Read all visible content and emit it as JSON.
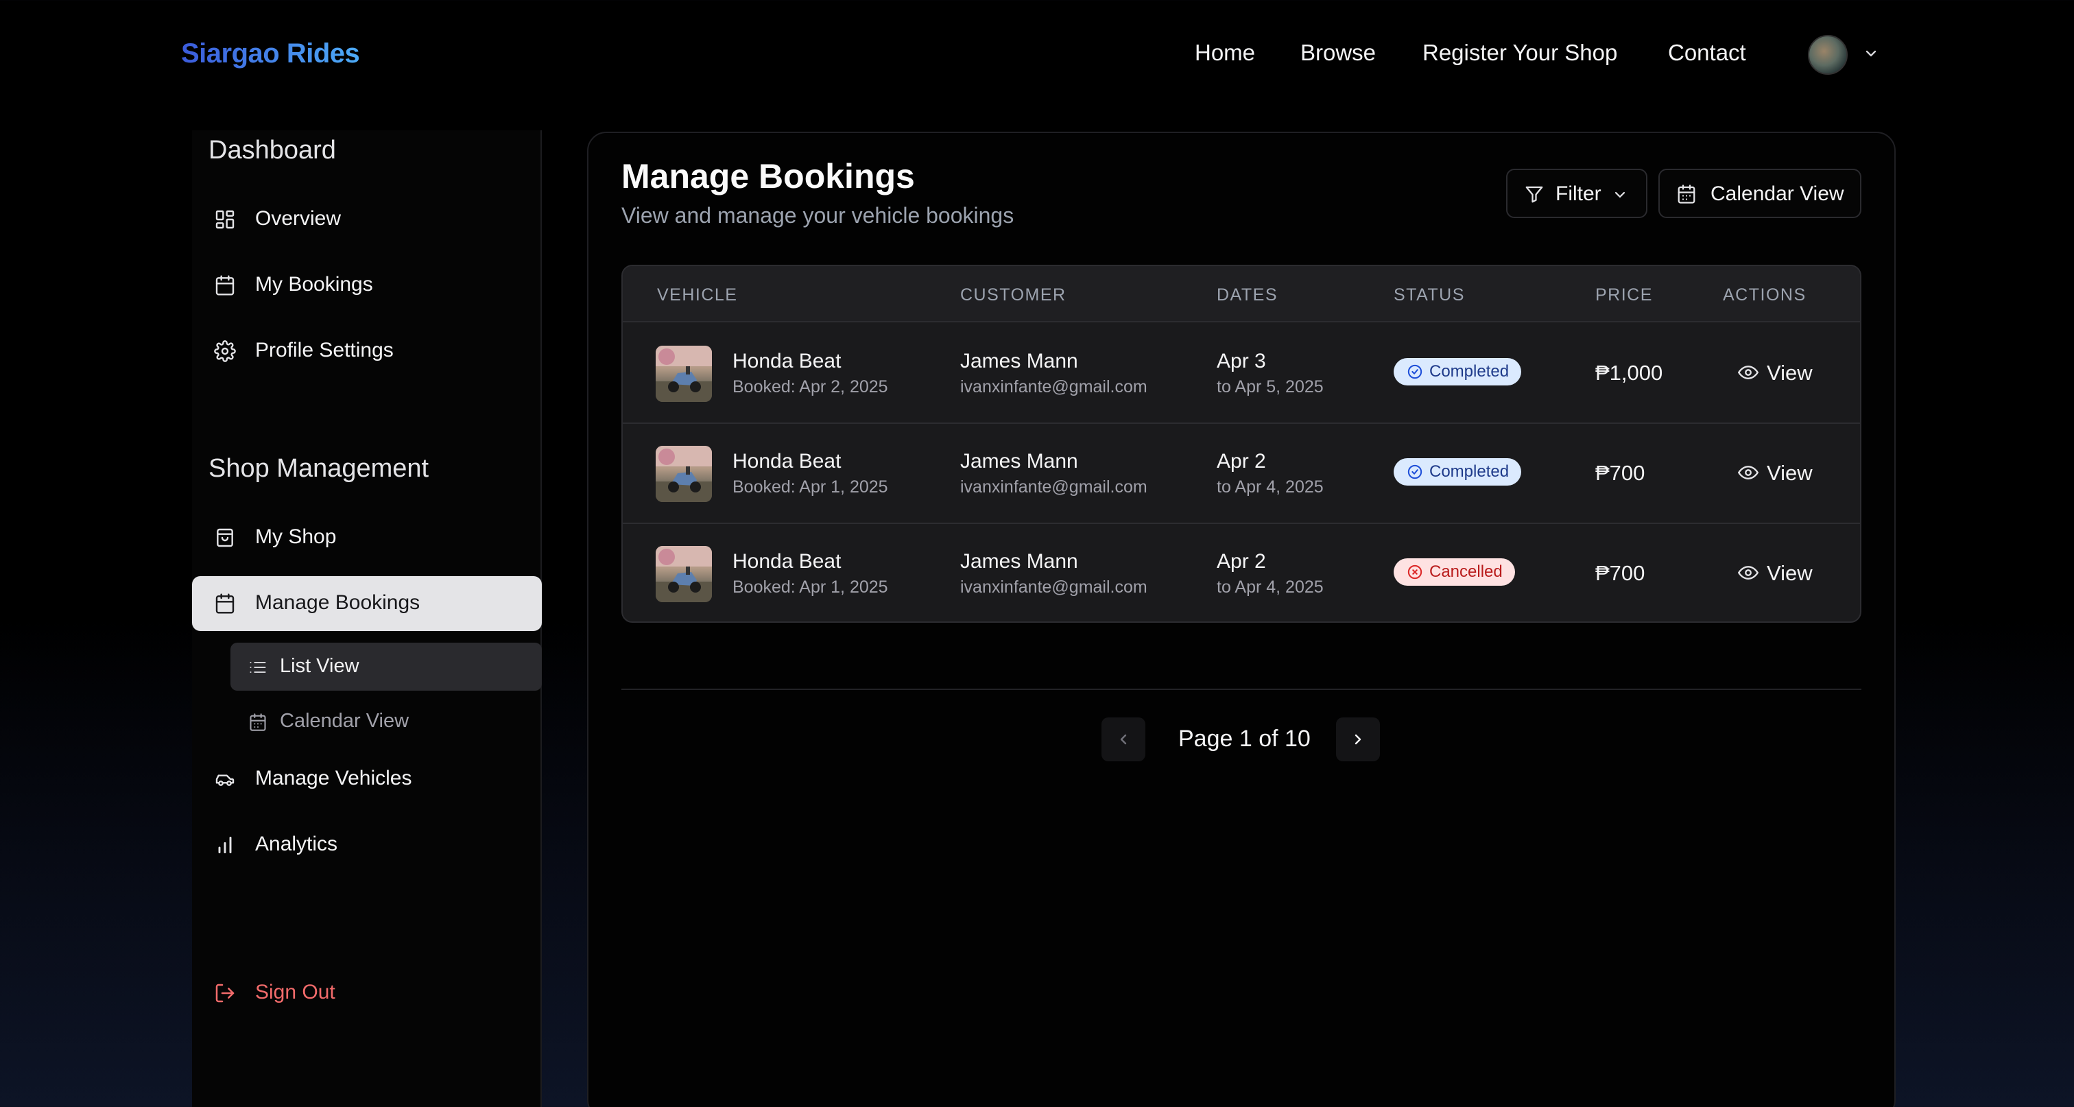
{
  "header": {
    "brand": "Siargao Rides",
    "nav": [
      "Home",
      "Browse",
      "Register Your Shop",
      "Contact"
    ]
  },
  "sidebar": {
    "dashboard_heading": "Dashboard",
    "dashboard_items": [
      {
        "label": "Overview",
        "icon": "grid-icon"
      },
      {
        "label": "My Bookings",
        "icon": "calendar-icon"
      },
      {
        "label": "Profile Settings",
        "icon": "gear-icon"
      }
    ],
    "shop_heading": "Shop Management",
    "shop_items": [
      {
        "label": "My Shop",
        "icon": "shopping-bag-icon"
      },
      {
        "label": "Manage Bookings",
        "icon": "calendar-icon",
        "active": true
      },
      {
        "label": "Manage Vehicles",
        "icon": "car-icon"
      },
      {
        "label": "Analytics",
        "icon": "bar-chart-icon"
      }
    ],
    "sub_items": [
      {
        "label": "List View",
        "icon": "list-icon",
        "active": true
      },
      {
        "label": "Calendar View",
        "icon": "calendar-icon"
      }
    ],
    "signout": "Sign Out"
  },
  "main": {
    "title": "Manage Bookings",
    "subtitle": "View and manage your vehicle bookings",
    "filter_label": "Filter",
    "calendar_label": "Calendar View"
  },
  "table": {
    "columns": [
      "VEHICLE",
      "CUSTOMER",
      "DATES",
      "STATUS",
      "PRICE",
      "ACTIONS"
    ],
    "rows": [
      {
        "vehicle": "Honda Beat",
        "booked": "Booked: Apr 2, 2025",
        "customer": "James Mann",
        "email": "ivanxinfante@gmail.com",
        "start": "Apr 3",
        "end": "to Apr 5, 2025",
        "status": "Completed",
        "price": "₱1,000",
        "action": "View"
      },
      {
        "vehicle": "Honda Beat",
        "booked": "Booked: Apr 1, 2025",
        "customer": "James Mann",
        "email": "ivanxinfante@gmail.com",
        "start": "Apr 2",
        "end": "to Apr 4, 2025",
        "status": "Completed",
        "price": "₱700",
        "action": "View"
      },
      {
        "vehicle": "Honda Beat",
        "booked": "Booked: Apr 1, 2025",
        "customer": "James Mann",
        "email": "ivanxinfante@gmail.com",
        "start": "Apr 2",
        "end": "to Apr 4, 2025",
        "status": "Cancelled",
        "price": "₱700",
        "action": "View"
      }
    ]
  },
  "pagination": {
    "text": "Page 1 of 10"
  },
  "colors": {
    "brand_start": "#3b5bdb",
    "brand_end": "#4dabf7",
    "completed_bg": "#dbeafe",
    "cancelled_bg": "#fee2e2",
    "signout": "#f26b6b"
  }
}
